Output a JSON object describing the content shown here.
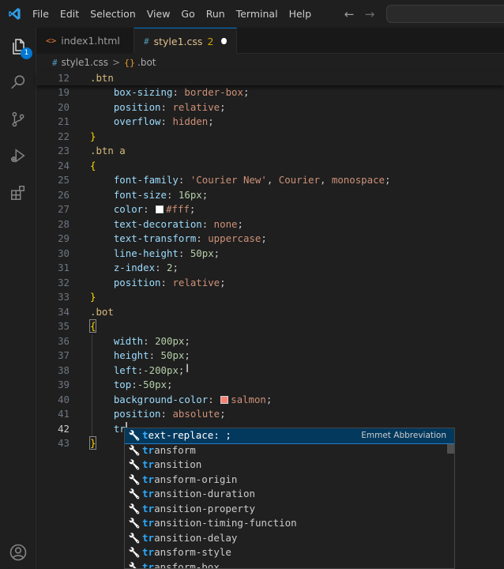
{
  "menu": [
    "File",
    "Edit",
    "Selection",
    "View",
    "Go",
    "Run",
    "Terminal",
    "Help"
  ],
  "nav": {
    "back": "←",
    "forward": "→"
  },
  "activity": {
    "explorer_badge": "1"
  },
  "tabs": [
    {
      "icon": "<>",
      "label": "index1.html"
    },
    {
      "icon": "#",
      "label": "style1.css",
      "problems": "2"
    }
  ],
  "breadcrumb": {
    "file_icon": "#",
    "file": "style1.css",
    "separator": ">",
    "symbol": ".bot"
  },
  "sticky": {
    "line": "12",
    "text": ".btn"
  },
  "lines": [
    {
      "n": "19",
      "parts": [
        {
          "c": "prop",
          "t": "    box-sizing"
        },
        {
          "c": "punc",
          "t": ": "
        },
        {
          "c": "val",
          "t": "border-box"
        },
        {
          "c": "punc",
          "t": ";"
        }
      ]
    },
    {
      "n": "20",
      "parts": [
        {
          "c": "prop",
          "t": "    position"
        },
        {
          "c": "punc",
          "t": ": "
        },
        {
          "c": "val",
          "t": "relative"
        },
        {
          "c": "punc",
          "t": ";"
        }
      ]
    },
    {
      "n": "21",
      "parts": [
        {
          "c": "prop",
          "t": "    overflow"
        },
        {
          "c": "punc",
          "t": ": "
        },
        {
          "c": "val",
          "t": "hidden"
        },
        {
          "c": "punc",
          "t": ";"
        }
      ]
    },
    {
      "n": "22",
      "parts": [
        {
          "c": "brace",
          "t": "}"
        }
      ]
    },
    {
      "n": "23",
      "parts": [
        {
          "c": "sel",
          "t": ".btn a"
        }
      ]
    },
    {
      "n": "24",
      "parts": [
        {
          "c": "brace",
          "t": "{"
        }
      ]
    },
    {
      "n": "25",
      "parts": [
        {
          "c": "prop",
          "t": "    font-family"
        },
        {
          "c": "punc",
          "t": ": "
        },
        {
          "c": "val",
          "t": "'Courier New'"
        },
        {
          "c": "punc",
          "t": ", "
        },
        {
          "c": "val",
          "t": "Courier"
        },
        {
          "c": "punc",
          "t": ", "
        },
        {
          "c": "val",
          "t": "monospace"
        },
        {
          "c": "punc",
          "t": ";"
        }
      ]
    },
    {
      "n": "26",
      "parts": [
        {
          "c": "prop",
          "t": "    font-size"
        },
        {
          "c": "punc",
          "t": ": "
        },
        {
          "c": "num",
          "t": "16px"
        },
        {
          "c": "punc",
          "t": ";"
        }
      ]
    },
    {
      "n": "27",
      "parts": [
        {
          "c": "prop",
          "t": "    color"
        },
        {
          "c": "punc",
          "t": ": "
        },
        {
          "c": "swatch",
          "t": "#ffffff"
        },
        {
          "c": "val",
          "t": "#fff"
        },
        {
          "c": "punc",
          "t": ";"
        }
      ]
    },
    {
      "n": "28",
      "parts": [
        {
          "c": "prop",
          "t": "    text-decoration"
        },
        {
          "c": "punc",
          "t": ": "
        },
        {
          "c": "val",
          "t": "none"
        },
        {
          "c": "punc",
          "t": ";"
        }
      ]
    },
    {
      "n": "29",
      "parts": [
        {
          "c": "prop",
          "t": "    text-transform"
        },
        {
          "c": "punc",
          "t": ": "
        },
        {
          "c": "val",
          "t": "uppercase"
        },
        {
          "c": "punc",
          "t": ";"
        }
      ]
    },
    {
      "n": "30",
      "parts": [
        {
          "c": "prop",
          "t": "    line-height"
        },
        {
          "c": "punc",
          "t": ": "
        },
        {
          "c": "num",
          "t": "50px"
        },
        {
          "c": "punc",
          "t": ";"
        }
      ]
    },
    {
      "n": "31",
      "parts": [
        {
          "c": "prop",
          "t": "    z-index"
        },
        {
          "c": "punc",
          "t": ": "
        },
        {
          "c": "num",
          "t": "2"
        },
        {
          "c": "punc",
          "t": ";"
        }
      ]
    },
    {
      "n": "32",
      "parts": [
        {
          "c": "prop",
          "t": "    position"
        },
        {
          "c": "punc",
          "t": ": "
        },
        {
          "c": "val",
          "t": "relative"
        },
        {
          "c": "punc",
          "t": ";"
        }
      ]
    },
    {
      "n": "33",
      "parts": [
        {
          "c": "brace",
          "t": "}"
        }
      ]
    },
    {
      "n": "34",
      "parts": [
        {
          "c": "sel",
          "t": ".bot"
        }
      ]
    },
    {
      "n": "35",
      "parts": [
        {
          "c": "brace box",
          "t": "{"
        }
      ]
    },
    {
      "n": "36",
      "parts": [
        {
          "c": "prop",
          "t": "    width"
        },
        {
          "c": "punc",
          "t": ": "
        },
        {
          "c": "num",
          "t": "200px"
        },
        {
          "c": "punc",
          "t": ";"
        }
      ]
    },
    {
      "n": "37",
      "parts": [
        {
          "c": "prop",
          "t": "    height"
        },
        {
          "c": "punc",
          "t": ": "
        },
        {
          "c": "num",
          "t": "50px"
        },
        {
          "c": "punc",
          "t": ";"
        }
      ]
    },
    {
      "n": "38",
      "parts": [
        {
          "c": "prop",
          "t": "    left"
        },
        {
          "c": "punc",
          "t": ":"
        },
        {
          "c": "num",
          "t": "-200px"
        },
        {
          "c": "punc",
          "t": ";"
        }
      ]
    },
    {
      "n": "39",
      "parts": [
        {
          "c": "prop",
          "t": "    top"
        },
        {
          "c": "punc",
          "t": ":"
        },
        {
          "c": "num",
          "t": "-50px"
        },
        {
          "c": "punc",
          "t": ";"
        }
      ]
    },
    {
      "n": "40",
      "parts": [
        {
          "c": "prop",
          "t": "    background-color"
        },
        {
          "c": "punc",
          "t": ": "
        },
        {
          "c": "swatch",
          "t": "#fa8072"
        },
        {
          "c": "val",
          "t": "salmon"
        },
        {
          "c": "punc",
          "t": ";"
        }
      ]
    },
    {
      "n": "41",
      "parts": [
        {
          "c": "prop",
          "t": "    position"
        },
        {
          "c": "punc",
          "t": ": "
        },
        {
          "c": "val",
          "t": "absolute"
        },
        {
          "c": "punc",
          "t": ";"
        }
      ]
    },
    {
      "n": "42",
      "current": true,
      "parts": [
        {
          "c": "prop",
          "t": "    tr"
        },
        {
          "c": "cursor",
          "t": ""
        }
      ]
    },
    {
      "n": "43",
      "parts": [
        {
          "c": "brace box",
          "t": "}"
        }
      ]
    }
  ],
  "suggestions": [
    {
      "match": "t",
      "rest": "ext-replace: ;",
      "detail": "Emmet Abbreviation",
      "focused": true
    },
    {
      "match": "tr",
      "rest": "ansform"
    },
    {
      "match": "tr",
      "rest": "ansition"
    },
    {
      "match": "tr",
      "rest": "ansform-origin"
    },
    {
      "match": "tr",
      "rest": "ansition-duration"
    },
    {
      "match": "tr",
      "rest": "ansition-property"
    },
    {
      "match": "tr",
      "rest": "ansition-timing-function"
    },
    {
      "match": "tr",
      "rest": "ansition-delay"
    },
    {
      "match": "tr",
      "rest": "ansform-style"
    },
    {
      "match": "tr",
      "rest": "ansform-box"
    }
  ],
  "colors": {
    "accent": "#0078d4",
    "modified_tab": "#e2c08d",
    "suggest_focus": "#04395e",
    "match": "#2aaaff"
  }
}
